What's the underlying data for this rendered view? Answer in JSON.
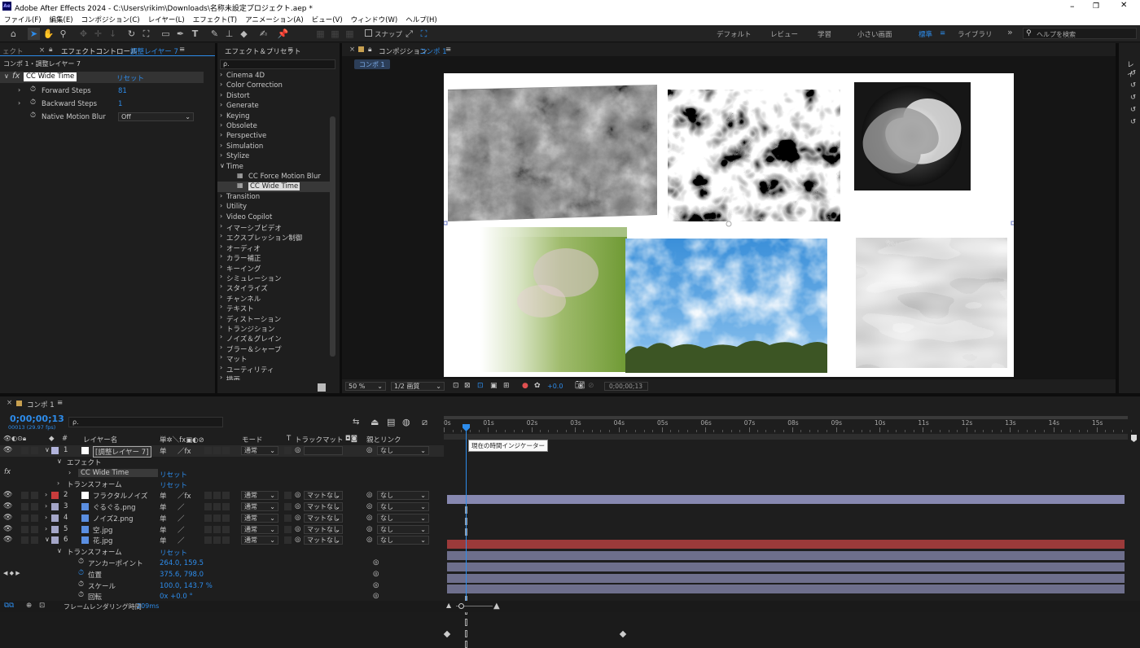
{
  "title": {
    "app_badge": "Ae",
    "text": "Adobe After Effects 2024 - C:\\Users\\rikim\\Downloads\\名称未設定プロジェクト.aep *",
    "min": "–",
    "max": "❐",
    "close": "✕"
  },
  "menu": [
    "ファイル(F)",
    "編集(E)",
    "コンポジション(C)",
    "レイヤー(L)",
    "エフェクト(T)",
    "アニメーション(A)",
    "ビュー(V)",
    "ウィンドウ(W)",
    "ヘルプ(H)"
  ],
  "toolbar": {
    "snap_label": "スナップ",
    "workspaces": [
      "デフォルト",
      "レビュー",
      "学習",
      "小さい画面",
      "標準",
      "ライブラリ"
    ],
    "active_workspace": "標準",
    "help_placeholder": "ヘルプを検索",
    "more": "»"
  },
  "left_panel": {
    "tab_prev": "ェクト",
    "tab_label": "エフェクトコントロール",
    "tab_layer": "調整レイヤー 7",
    "breadcrumb": "コンポ 1・調整レイヤー 7",
    "effect_name": "CC Wide Time",
    "reset": "リセット",
    "props": [
      {
        "name": "Forward Steps",
        "value": "81"
      },
      {
        "name": "Backward Steps",
        "value": "1"
      },
      {
        "name": "Native Motion Blur",
        "value": "Off"
      }
    ]
  },
  "effects_panel": {
    "tab": "エフェクト＆プリセット",
    "search_placeholder": "ρ.",
    "items": [
      {
        "t": "Cinema 4D",
        "o": false
      },
      {
        "t": "Color Correction",
        "o": false
      },
      {
        "t": "Distort",
        "o": false
      },
      {
        "t": "Generate",
        "o": false
      },
      {
        "t": "Keying",
        "o": false
      },
      {
        "t": "Obsolete",
        "o": false
      },
      {
        "t": "Perspective",
        "o": false
      },
      {
        "t": "Simulation",
        "o": false
      },
      {
        "t": "Stylize",
        "o": false
      },
      {
        "t": "Time",
        "o": true
      }
    ],
    "time_children": [
      "CC Force Motion Blur",
      "CC Wide Time"
    ],
    "items2": [
      "Transition",
      "Utility",
      "Video Copilot",
      "イマーシブビデオ",
      "エクスプレッション制御",
      "オーディオ",
      "カラー補正",
      "キーイング",
      "シミュレーション",
      "スタイライズ",
      "チャンネル",
      "テキスト",
      "ディストーション",
      "トランジション",
      "ノイズ＆グレイン",
      "ブラー＆シャープ",
      "マット",
      "ユーティリティ",
      "描画"
    ]
  },
  "composition": {
    "tab_label": "コンポジション",
    "comp_name": "コンポ 1",
    "zoom": "50 %",
    "resolution": "1/2 画質",
    "exposure": "+0.0",
    "timecode": "0;00;00;13"
  },
  "right_panel": {
    "tab": "レイ"
  },
  "timeline": {
    "tab": "コンポ 1",
    "timecode": "0;00;00;13",
    "fps": "00013 (29.97 fps)",
    "search_placeholder": "ρ.",
    "headers": {
      "layer_name": "レイヤー名",
      "switches": "単✲＼fx▣◐⊘",
      "mode": "モード",
      "t": "T",
      "track_matte": "トラックマット",
      "parent": "親とリンク"
    },
    "ticks": [
      "0s",
      "01s",
      "02s",
      "03s",
      "04s",
      "05s",
      "06s",
      "07s",
      "08s",
      "09s",
      "10s",
      "11s",
      "12s",
      "13s",
      "14s",
      "15s"
    ],
    "tooltip": "現在の時間インジケーター",
    "layers": [
      {
        "num": "1",
        "name": "[調整レイヤー 7]",
        "color": "#b2b4dc",
        "mode": "通常",
        "matte": "",
        "parent": "なし",
        "bar": "#8788b0"
      },
      {
        "num": "2",
        "name": "フラクタルノイズ",
        "color": "#c83c3c",
        "mode": "通常",
        "matte": "マットなし",
        "parent": "なし",
        "bar": "#9b3a3a"
      },
      {
        "num": "3",
        "name": "ぐるぐる.png",
        "color": "#a4a6c8",
        "mode": "通常",
        "matte": "マットなし",
        "parent": "なし",
        "bar": "#6e6f8c"
      },
      {
        "num": "4",
        "name": "ノイズ2.png",
        "color": "#a4a6c8",
        "mode": "通常",
        "matte": "マットなし",
        "parent": "なし",
        "bar": "#6e6f8c"
      },
      {
        "num": "5",
        "name": "空.jpg",
        "color": "#a4a6c8",
        "mode": "通常",
        "matte": "マットなし",
        "parent": "なし",
        "bar": "#6e6f8c"
      },
      {
        "num": "6",
        "name": "花.jpg",
        "color": "#a4a6c8",
        "mode": "通常",
        "matte": "マットなし",
        "parent": "なし",
        "bar": "#6e6f8c"
      }
    ],
    "effect_group": "エフェクト",
    "effect_item": "CC Wide Time",
    "transform": "トランスフォーム",
    "reset": "リセット",
    "transform_props": [
      {
        "name": "アンカーポイント",
        "value": "264.0, 159.5"
      },
      {
        "name": "位置",
        "value": "375.6, 798.0"
      },
      {
        "name": "スケール",
        "value": "100.0, 143.7 %"
      },
      {
        "name": "回転",
        "value": "0x +0.0 °"
      }
    ],
    "render_time_label": "フレームレンダリング時間",
    "render_time": "209ms"
  }
}
